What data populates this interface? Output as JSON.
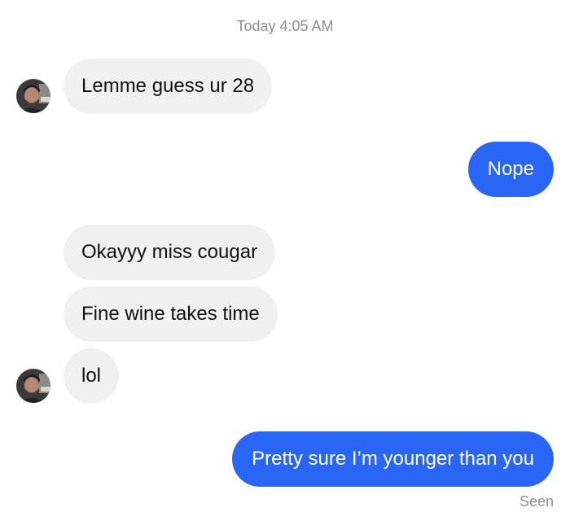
{
  "conversation": {
    "timestamp": "Today 4:05 AM",
    "messages": [
      {
        "from": "them",
        "text": "Lemme guess ur 28"
      },
      {
        "from": "me",
        "text": "Nope"
      },
      {
        "from": "them",
        "text": "Okayyy miss cougar"
      },
      {
        "from": "them",
        "text": "Fine wine takes time"
      },
      {
        "from": "them",
        "text": "lol"
      },
      {
        "from": "me",
        "text": "Pretty sure I’m younger than you"
      }
    ],
    "read_receipt": "Seen"
  },
  "colors": {
    "outgoing_bubble": "#2a66f6",
    "incoming_bubble": "#f0f0f0",
    "meta_text": "#8e8e93"
  },
  "icons": {
    "contact_avatar": "profile-photo"
  }
}
